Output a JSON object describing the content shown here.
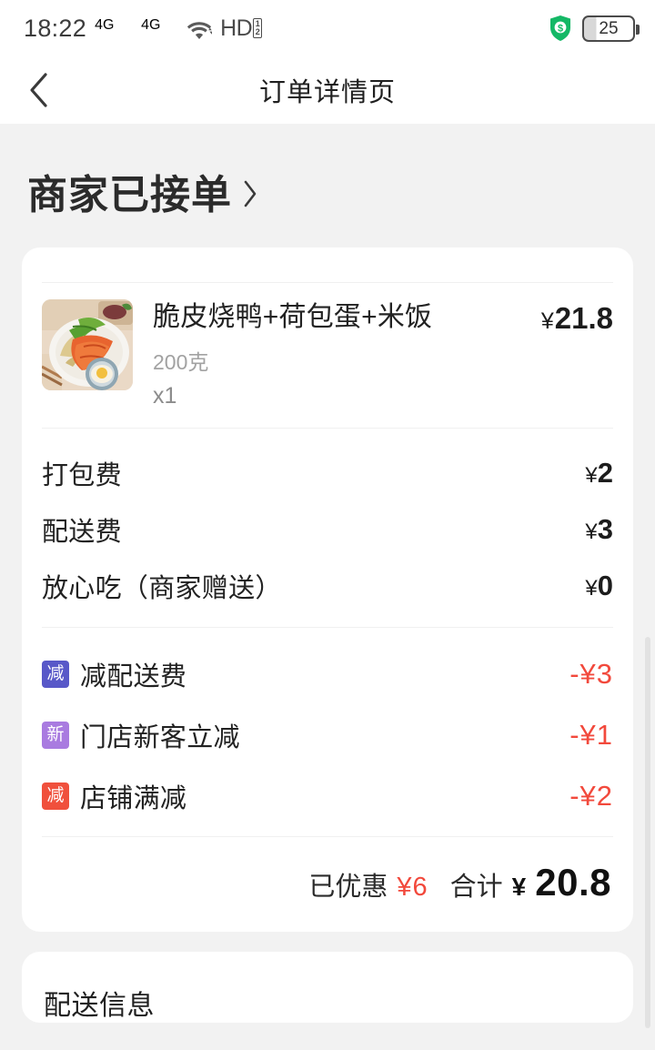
{
  "status_bar": {
    "time": "18:22",
    "network_label": "4G",
    "hd_label": "HD",
    "hd_sub_top": "1",
    "hd_sub_bottom": "2",
    "battery_level": "25",
    "shield_glyph": "$",
    "icons": [
      "signal-4g-sim1",
      "signal-4g-sim2",
      "wifi",
      "hd",
      "shield",
      "battery"
    ]
  },
  "nav": {
    "back_icon": "chevron-left-icon",
    "title": "订单详情页"
  },
  "order_status": {
    "text": "商家已接单",
    "chevron": "chevron-right-icon"
  },
  "item": {
    "name": "脆皮烧鸭+荷包蛋+米饭",
    "spec": "200克",
    "quantity": "x1",
    "currency": "¥",
    "price": "21.8"
  },
  "fees": [
    {
      "label": "打包费",
      "currency": "¥",
      "amount": "2"
    },
    {
      "label": "配送费",
      "currency": "¥",
      "amount": "3"
    },
    {
      "label": "放心吃（商家赠送）",
      "currency": "¥",
      "amount": "0"
    }
  ],
  "discounts": [
    {
      "badge": "减",
      "badge_color": "#5858c8",
      "label": "减配送费",
      "amount": "-¥3"
    },
    {
      "badge": "新",
      "badge_color": "#a97be0",
      "label": "门店新客立减",
      "amount": "-¥1"
    },
    {
      "badge": "减",
      "badge_color": "#f0503c",
      "label": "店铺满减",
      "amount": "-¥2"
    }
  ],
  "totals": {
    "saved_label": "已优惠",
    "saved_amount": "¥6",
    "total_label": "合计",
    "total_currency": "¥",
    "total_amount": "20.8"
  },
  "delivery": {
    "title": "配送信息"
  },
  "colors": {
    "page_bg": "#f2f2f2",
    "card_bg": "#ffffff",
    "accent_red": "#f2493c",
    "text_primary": "#222222",
    "text_muted": "#a2a2a2"
  }
}
